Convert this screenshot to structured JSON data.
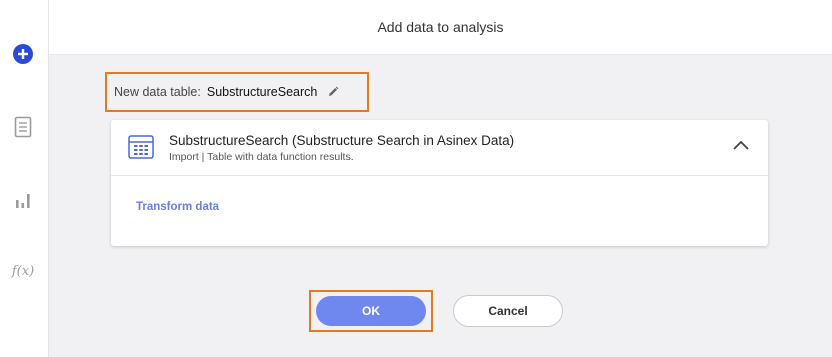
{
  "rail": {
    "icons": [
      "add-icon",
      "document-icon",
      "bar-chart-icon",
      "function-icon"
    ],
    "fx_label": "f(x)"
  },
  "header": {
    "title": "Add data to analysis"
  },
  "new_table": {
    "label": "New data table:",
    "name": "SubstructureSearch"
  },
  "card": {
    "title": "SubstructureSearch (Substructure Search in Asinex Data)",
    "subtitle": "Import  |  Table with data function results.",
    "transform_link": "Transform data"
  },
  "buttons": {
    "ok": "OK",
    "cancel": "Cancel"
  },
  "colors": {
    "accent": "#6f88ef",
    "highlight": "#e07b1f",
    "add_icon": "#2b4bd6",
    "link": "#6b7fe0"
  }
}
